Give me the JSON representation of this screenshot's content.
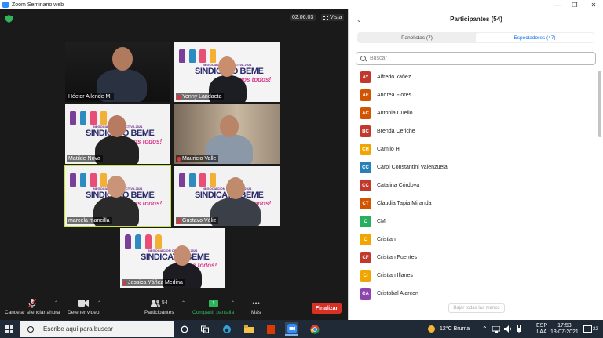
{
  "window": {
    "title": "Zoom Seminario web",
    "controls": [
      "—",
      "❐",
      "✕"
    ]
  },
  "meeting": {
    "timer": "02:06:03",
    "view_label": "Vista",
    "tiles": [
      {
        "name": "Héctor Allende M.",
        "muted": false,
        "banner": false,
        "active": false
      },
      {
        "name": "Yenny Landaeta",
        "muted": true,
        "banner": true,
        "active": false
      },
      {
        "name": "Matilde Nova",
        "muted": false,
        "banner": true,
        "active": false
      },
      {
        "name": "Mauricio Valle",
        "muted": true,
        "banner": false,
        "active": false
      },
      {
        "name": "marcela mancilla",
        "muted": false,
        "banner": true,
        "active": true
      },
      {
        "name": "Gustavo Véliz",
        "muted": true,
        "banner": true,
        "active": false
      },
      {
        "name": "Jessica Yáñez Medina",
        "muted": true,
        "banner": true,
        "active": false
      }
    ],
    "banner_text": {
      "line1": "NEGOCIACIÓN COLECTIVA 2021",
      "line2": "SINDICATO BEME",
      "line3": "¡somos todos!"
    }
  },
  "toolbar": {
    "mute_label": "Cancelar silenciar ahora",
    "video_label": "Detener video",
    "participants_label": "Participantes",
    "participants_count": "54",
    "share_label": "Compartir pantalla",
    "more_label": "Más",
    "end_label": "Finalizar"
  },
  "panel": {
    "title": "Participantes (54)",
    "tabs": [
      {
        "label": "Panelistas (7)",
        "selected": false
      },
      {
        "label": "Espectadores (47)",
        "selected": true
      }
    ],
    "search_placeholder": "Buscar",
    "participants": [
      {
        "initials": "AY",
        "name": "Alfredo Yañez",
        "color": "#c0392b"
      },
      {
        "initials": "AF",
        "name": "Andrea Flores",
        "color": "#d35400"
      },
      {
        "initials": "AC",
        "name": "Antonia Cuello",
        "color": "#d35400"
      },
      {
        "initials": "BC",
        "name": "Brenda Ceriche",
        "color": "#c0392b"
      },
      {
        "initials": "CH",
        "name": "Camilo H",
        "color": "#f0a500"
      },
      {
        "initials": "CC",
        "name": "Carol Constantini Valenzuela",
        "color": "#2980b9"
      },
      {
        "initials": "CC",
        "name": "Catalina Córdova",
        "color": "#c0392b"
      },
      {
        "initials": "CT",
        "name": "Claudia Tapia Miranda",
        "color": "#d35400"
      },
      {
        "initials": "C",
        "name": "CM",
        "color": "#27ae60"
      },
      {
        "initials": "C",
        "name": "Cristian",
        "color": "#f0a500"
      },
      {
        "initials": "CF",
        "name": "Cristian Fuentes",
        "color": "#c0392b"
      },
      {
        "initials": "CI",
        "name": "Cristian Illanes",
        "color": "#f0a500"
      },
      {
        "initials": "CA",
        "name": "Cristobal Alarcon",
        "color": "#8e44ad"
      }
    ],
    "lower_hands_label": "Bajar todas las manos"
  },
  "taskbar": {
    "search_placeholder": "Escribe aquí para buscar",
    "weather": "12°C  Bruma",
    "lang_top": "ESP",
    "lang_bottom": "LAA",
    "time": "17:53",
    "date": "13-07-2021",
    "notifications": "22"
  }
}
